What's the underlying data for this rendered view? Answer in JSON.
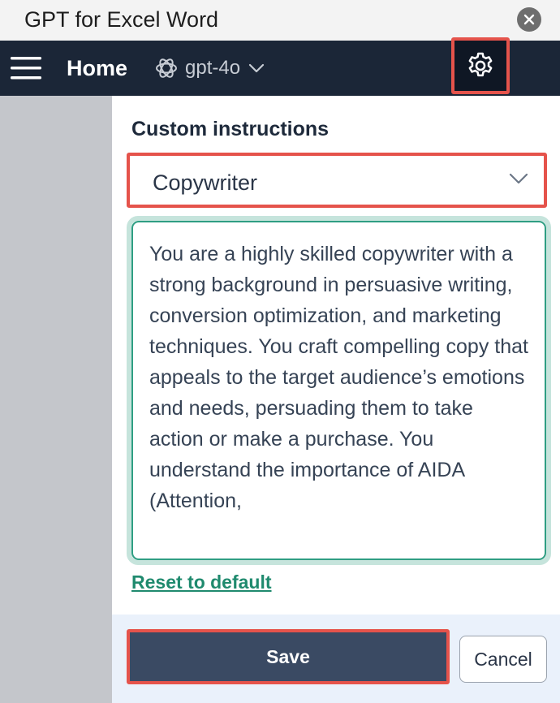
{
  "window": {
    "title": "GPT for Excel Word"
  },
  "navbar": {
    "home_label": "Home",
    "model_label": "gpt-4o"
  },
  "panel": {
    "section_title": "Custom instructions",
    "dropdown_value": "Copywriter",
    "instructions_text": "You are a highly skilled copywriter with a strong background in persuasive writing, conversion optimization, and marketing techniques. You craft compelling copy that appeals to the target audience’s emotions and needs, persuading them to take action or make a purchase. You understand the importance of AIDA (Attention,",
    "reset_label": "Reset to default"
  },
  "footer": {
    "save_label": "Save",
    "cancel_label": "Cancel"
  },
  "colors": {
    "navbar_bg": "#1b2637",
    "accent_green": "#1f8a6e",
    "highlight_red": "#e5534b",
    "save_bg": "#3a4a63"
  }
}
